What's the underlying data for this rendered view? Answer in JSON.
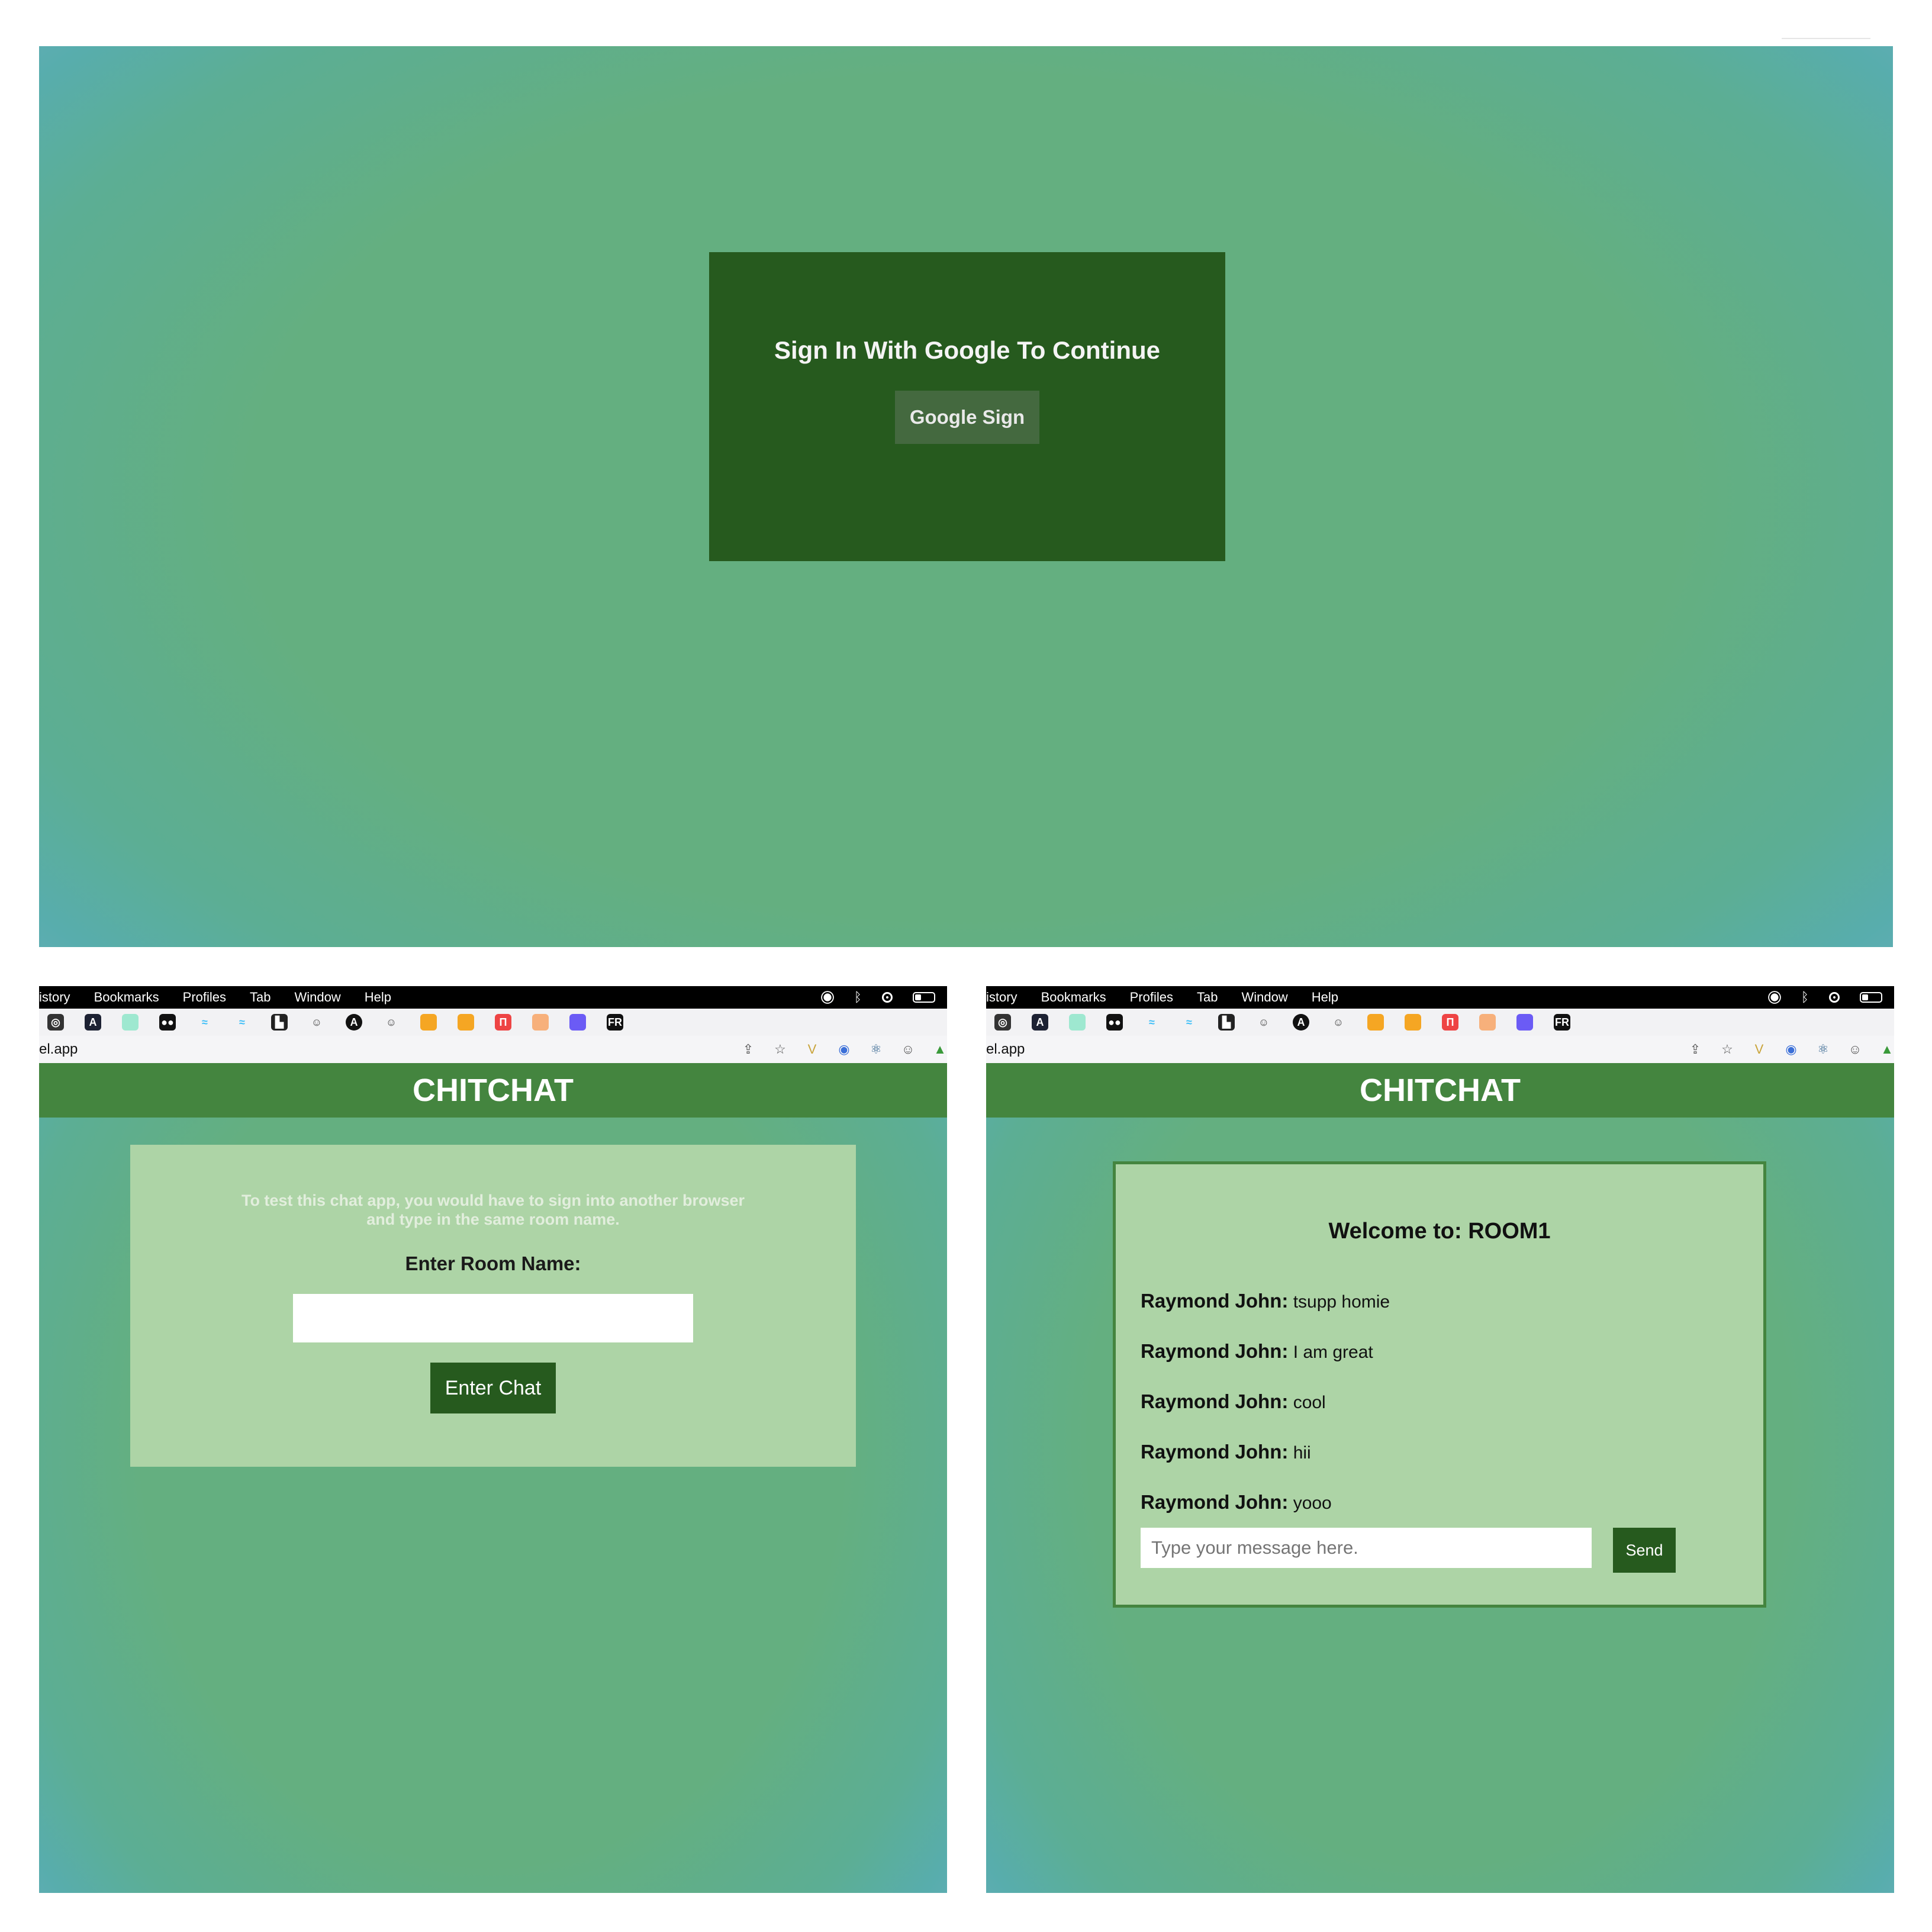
{
  "signin": {
    "title": "Sign In With Google To Continue",
    "button_label": "Google Sign"
  },
  "browser": {
    "menu_items": [
      "istory",
      "Bookmarks",
      "Profiles",
      "Tab",
      "Window",
      "Help"
    ],
    "url": "el.app"
  },
  "app": {
    "title": "CHITCHAT"
  },
  "room": {
    "hint_line1": "To test this chat app, you would have to sign into another browser",
    "hint_line2": "and type in the same room name.",
    "label": "Enter Room Name:",
    "input_value": "",
    "enter_label": "Enter Chat"
  },
  "chat": {
    "welcome": "Welcome to: ROOM1",
    "messages": [
      {
        "user": "Raymond John:",
        "text": "tsupp homie"
      },
      {
        "user": "Raymond John:",
        "text": "I am great"
      },
      {
        "user": "Raymond John:",
        "text": "cool"
      },
      {
        "user": "Raymond John:",
        "text": "hii"
      },
      {
        "user": "Raymond John:",
        "text": "yooo"
      }
    ],
    "input_placeholder": "Type your message here.",
    "send_label": "Send"
  },
  "colors": {
    "dark_green": "#265a1e",
    "header_green": "#44853f",
    "card_green": "#add4a6",
    "bg_green": "#64af80"
  }
}
